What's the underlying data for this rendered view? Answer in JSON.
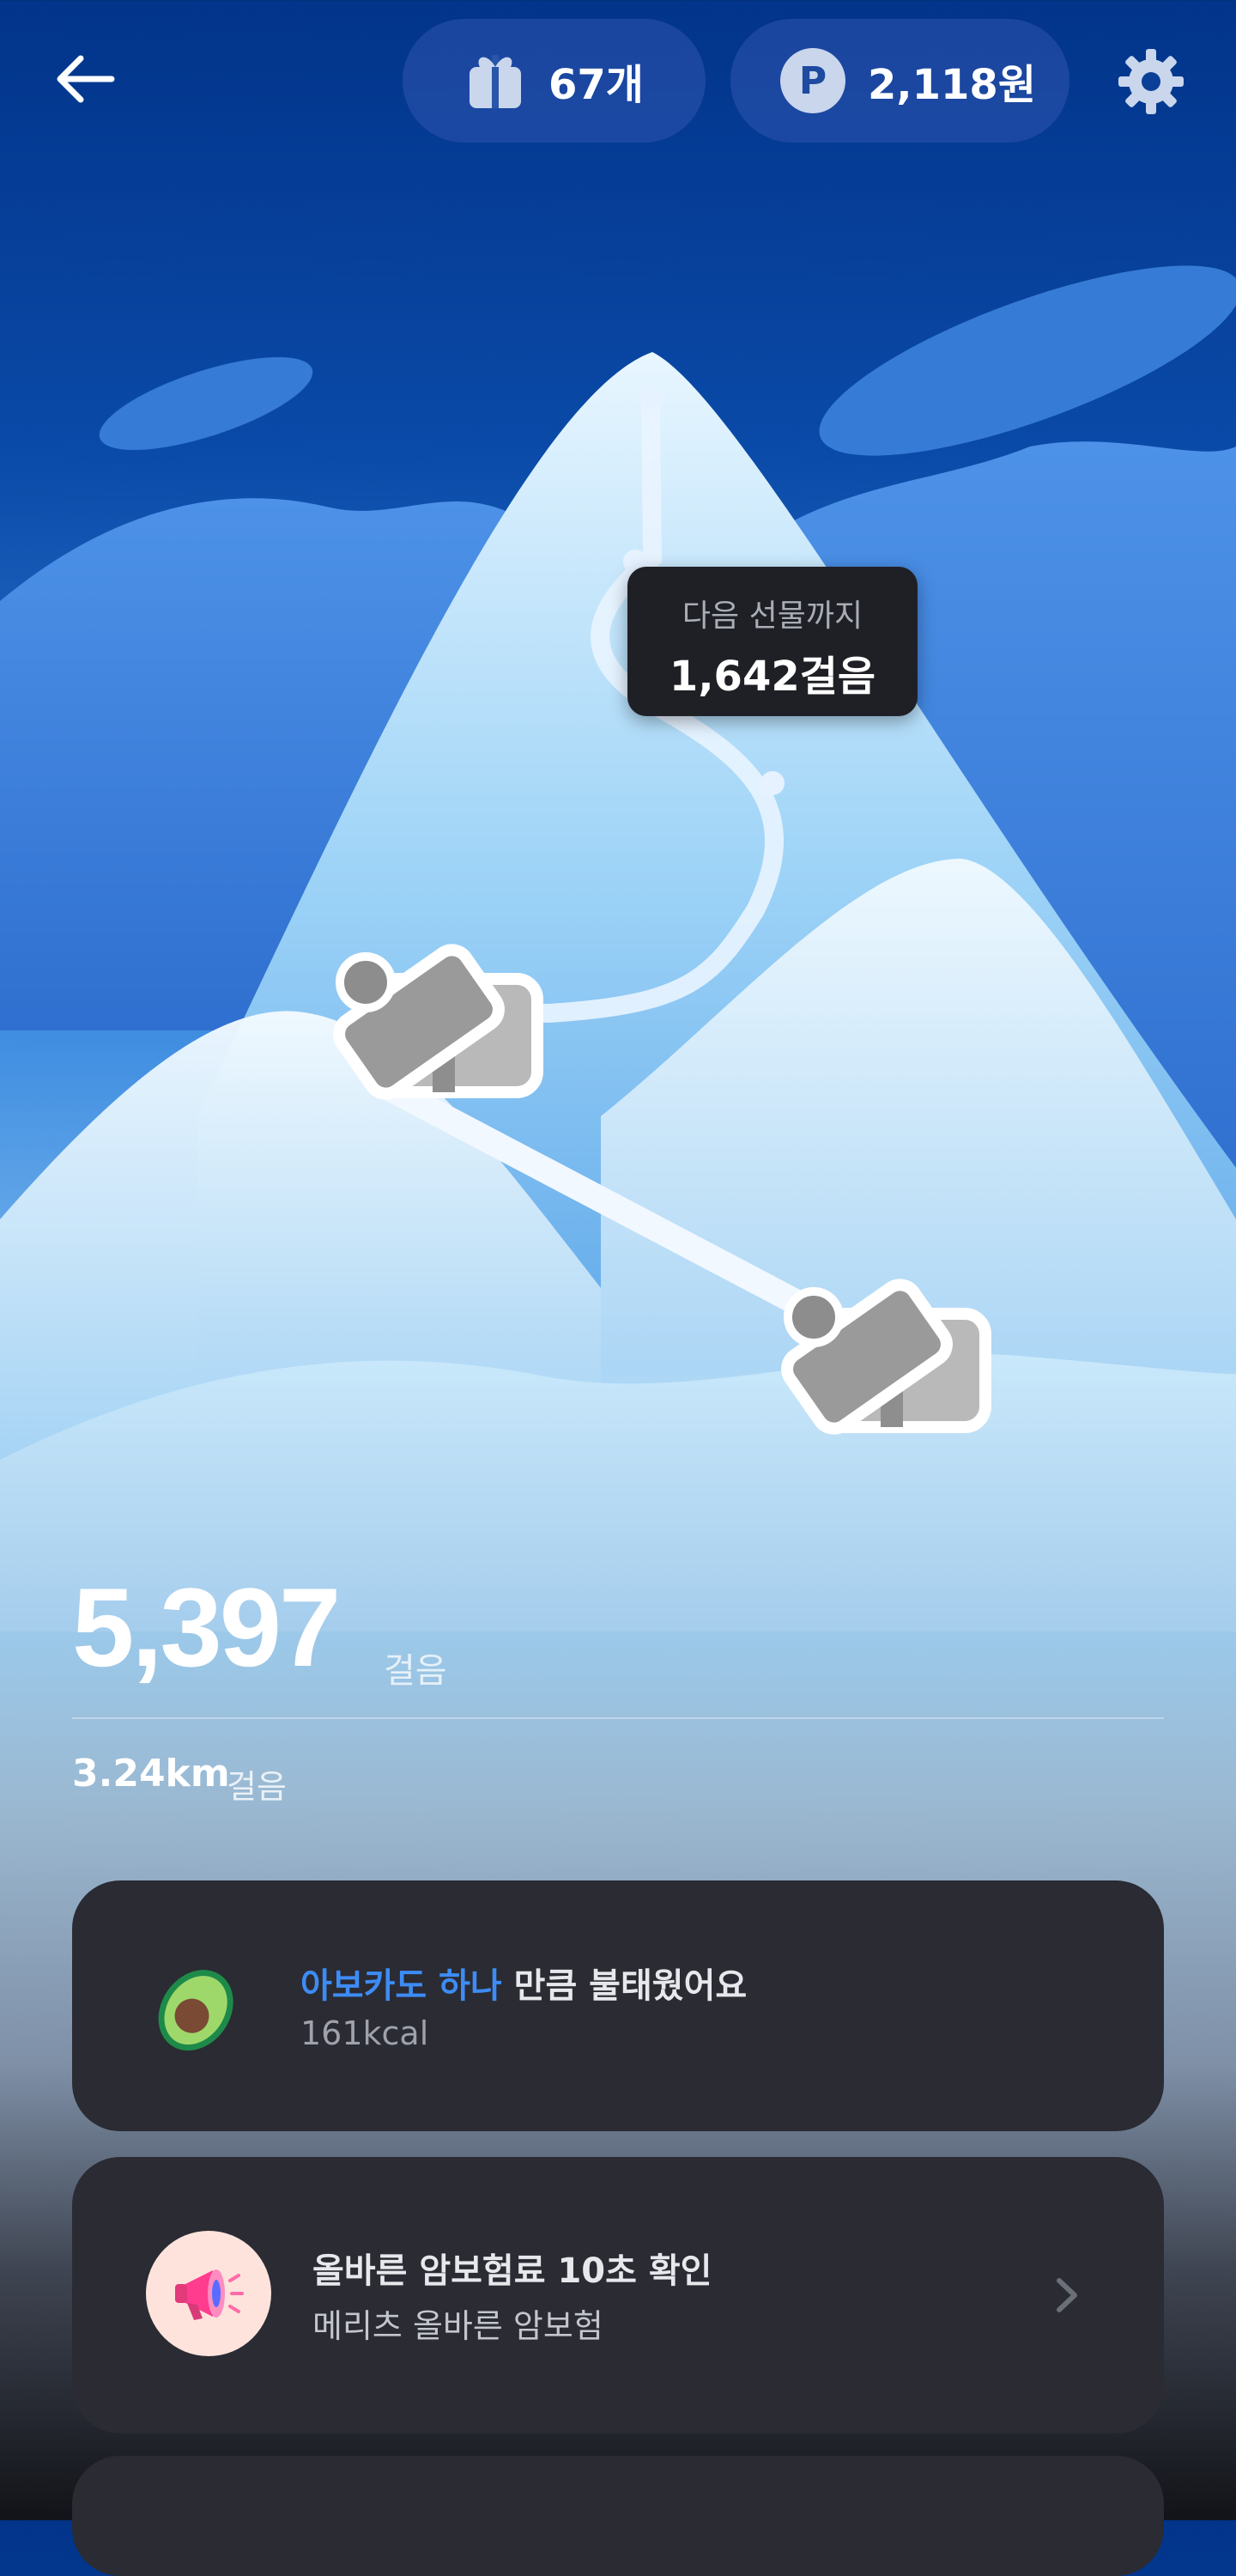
{
  "header": {
    "gift_count": "67개",
    "points": "2,118원",
    "points_icon_letter": "P"
  },
  "tooltip": {
    "label": "다음 선물까지",
    "value": "1,642걸음"
  },
  "stats": {
    "steps": "5,397",
    "steps_unit": "걸음",
    "distance": "3.24km",
    "distance_unit": "걸음"
  },
  "cards": {
    "avocado": {
      "highlight": "아보카도 하나",
      "title_rest": " 만큼 불태웠어요",
      "subtitle": "161kcal"
    },
    "ad": {
      "title": "올바른 암보험료 10초 확인",
      "subtitle": "메리츠 올바른 암보험"
    }
  },
  "colors": {
    "sky_top": "#02348a",
    "highlight_blue": "#3d8cf5",
    "card_bg": "#2a2b33",
    "tooltip_bg": "#1f2026"
  },
  "icons": [
    "back-arrow-icon",
    "gift-icon",
    "points-icon",
    "gear-icon",
    "gift-box-icon",
    "avocado-icon",
    "megaphone-icon",
    "chevron-right-icon"
  ]
}
